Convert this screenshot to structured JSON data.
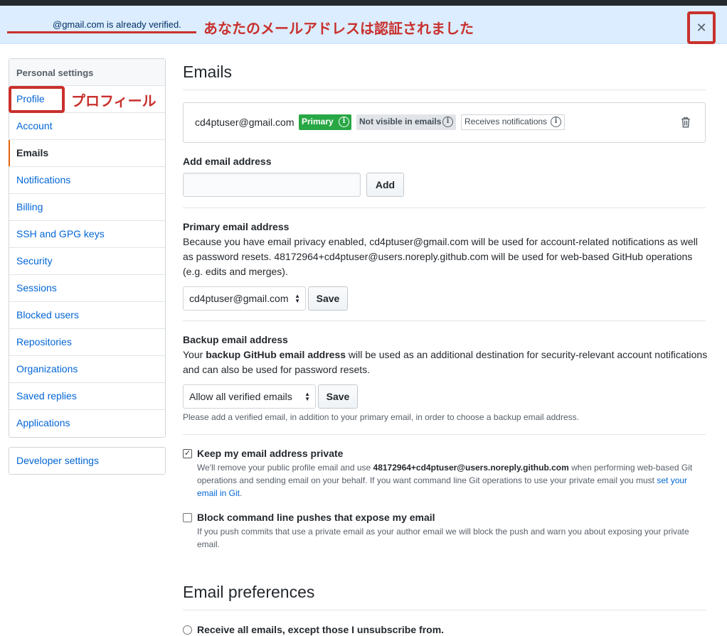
{
  "flash": {
    "message": "@gmail.com is already verified.",
    "annotation": "あなたのメールアドレスは認証されました",
    "close_glyph": "✕"
  },
  "sidebar": {
    "heading": "Personal settings",
    "items": [
      {
        "label": "Profile"
      },
      {
        "label": "Account"
      },
      {
        "label": "Emails"
      },
      {
        "label": "Notifications"
      },
      {
        "label": "Billing"
      },
      {
        "label": "SSH and GPG keys"
      },
      {
        "label": "Security"
      },
      {
        "label": "Sessions"
      },
      {
        "label": "Blocked users"
      },
      {
        "label": "Repositories"
      },
      {
        "label": "Organizations"
      },
      {
        "label": "Saved replies"
      },
      {
        "label": "Applications"
      }
    ],
    "selected": "Emails",
    "profile_annotation": "プロフィール",
    "developer_settings": "Developer settings"
  },
  "emails": {
    "title": "Emails",
    "address": "cd4ptuser@gmail.com",
    "badges": {
      "primary": "Primary",
      "not_visible": "Not visible in emails",
      "receives": "Receives notifications"
    }
  },
  "add_email": {
    "heading": "Add email address",
    "input_value": "",
    "button": "Add"
  },
  "primary_email": {
    "heading": "Primary email address",
    "description": "Because you have email privacy enabled, cd4ptuser@gmail.com will be used for account-related notifications as well as password resets. 48172964+cd4ptuser@users.noreply.github.com will be used for web-based GitHub operations (e.g. edits and merges).",
    "select_value": "cd4ptuser@gmail.com",
    "save": "Save"
  },
  "backup_email": {
    "heading": "Backup email address",
    "desc_pre": "Your ",
    "desc_bold": "backup GitHub email address",
    "desc_post": " will be used as an additional destination for security-relevant account notifications and can also be used for password resets.",
    "select_value": "Allow all verified emails",
    "save": "Save",
    "note": "Please add a verified email, in addition to your primary email, in order to choose a backup email address."
  },
  "keep_private": {
    "checked": true,
    "label": "Keep my email address private",
    "note_pre": "We'll remove your public profile email and use ",
    "note_bold": "48172964+cd4ptuser@users.noreply.github.com",
    "note_mid": " when performing web-based Git operations and sending email on your behalf. If you want command line Git operations to use your private email you must ",
    "note_link": "set your email in Git",
    "note_end": "."
  },
  "block_pushes": {
    "checked": false,
    "label": "Block command line pushes that expose my email",
    "note": "If you push commits that use a private email as your author email we will block the push and warn you about exposing your private email."
  },
  "preferences": {
    "title": "Email preferences",
    "option1": "Receive all emails, except those I unsubscribe from."
  },
  "colors": {
    "accent_red": "#c9302c",
    "link_blue": "#0366d6",
    "primary_green": "#28a745",
    "selected_marker": "#e36209",
    "flash_bg": "#dbedff"
  }
}
